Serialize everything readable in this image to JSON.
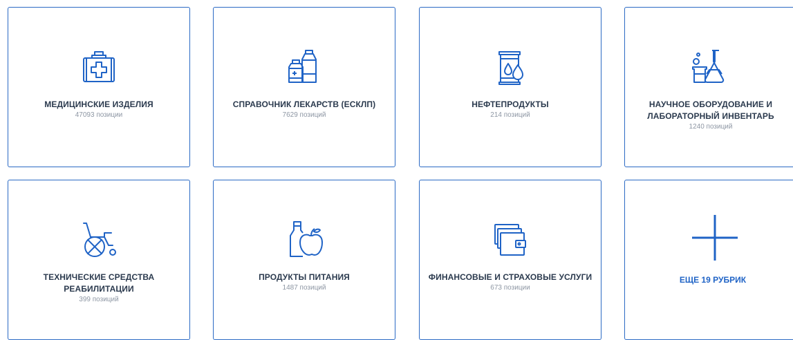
{
  "categories": [
    {
      "title": "МЕДИЦИНСКИЕ ИЗДЕЛИЯ",
      "count": "47093 позиции",
      "icon": "medical-kit-icon"
    },
    {
      "title": "СПРАВОЧНИК ЛЕКАРСТВ (ЕСКЛП)",
      "count": "7629 позиций",
      "icon": "medicine-bottles-icon"
    },
    {
      "title": "НЕФТЕПРОДУКТЫ",
      "count": "214 позиций",
      "icon": "oil-barrel-icon"
    },
    {
      "title": "НАУЧНОЕ ОБОРУДОВАНИЕ И ЛАБОРАТОРНЫЙ ИНВЕНТАРЬ",
      "count": "1240 позиций",
      "icon": "lab-flasks-icon"
    },
    {
      "title": "ТЕХНИЧЕСКИЕ СРЕДСТВА РЕАБИЛИТАЦИИ",
      "count": "399 позиций",
      "icon": "wheelchair-icon"
    },
    {
      "title": "ПРОДУКТЫ ПИТАНИЯ",
      "count": "1487 позиций",
      "icon": "food-bottle-apple-icon"
    },
    {
      "title": "ФИНАНСОВЫЕ И СТРАХОВЫЕ УСЛУГИ",
      "count": "673 позиции",
      "icon": "wallet-icon"
    }
  ],
  "more": {
    "label": "ЕЩЕ 19 РУБРИК",
    "icon": "plus-icon"
  },
  "colors": {
    "accent": "#1f63c6",
    "border": "#2a69c4",
    "title": "#2b3a4e",
    "count": "#8d96a3"
  }
}
